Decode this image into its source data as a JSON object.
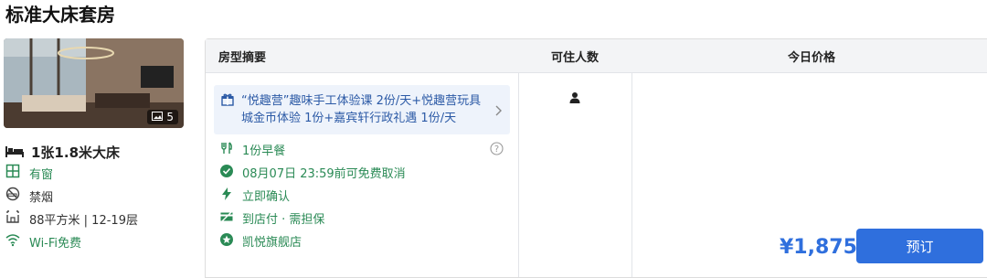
{
  "room": {
    "title": "标准大床套房",
    "photo_count": "5"
  },
  "bed": "1张1.8米大床",
  "features": [
    {
      "label": "有窗",
      "icon": "window-icon"
    },
    {
      "label": "禁烟",
      "icon": "no-smoking-icon"
    },
    {
      "label": "88平方米 | 12-19层",
      "icon": "area-icon"
    },
    {
      "label": "Wi-Fi免费",
      "icon": "wifi-icon"
    }
  ],
  "table": {
    "headers": [
      "房型摘要",
      "可住人数",
      "今日价格"
    ],
    "package": "“悦趣营”趣味手工体验课 2份/天+悦趣营玩具城金币体验 1份+嘉宾轩行政礼遇 1份/天",
    "items": [
      {
        "label": "1份早餐",
        "icon": "breakfast-icon"
      },
      {
        "label": "08月07日 23:59前可免费取消",
        "icon": "check-circle-icon"
      },
      {
        "label": "立即确认",
        "icon": "lightning-icon"
      },
      {
        "label": "到店付 · 需担保",
        "icon": "card-icon"
      },
      {
        "label": "凯悦旗舰店",
        "icon": "star-badge-icon"
      }
    ],
    "occupancy": "1"
  },
  "price": "¥1,875",
  "book_label": "预订",
  "colors": {
    "accent": "#2f6fdd",
    "green": "#2a8a55",
    "package_bg": "#eef3fb"
  }
}
